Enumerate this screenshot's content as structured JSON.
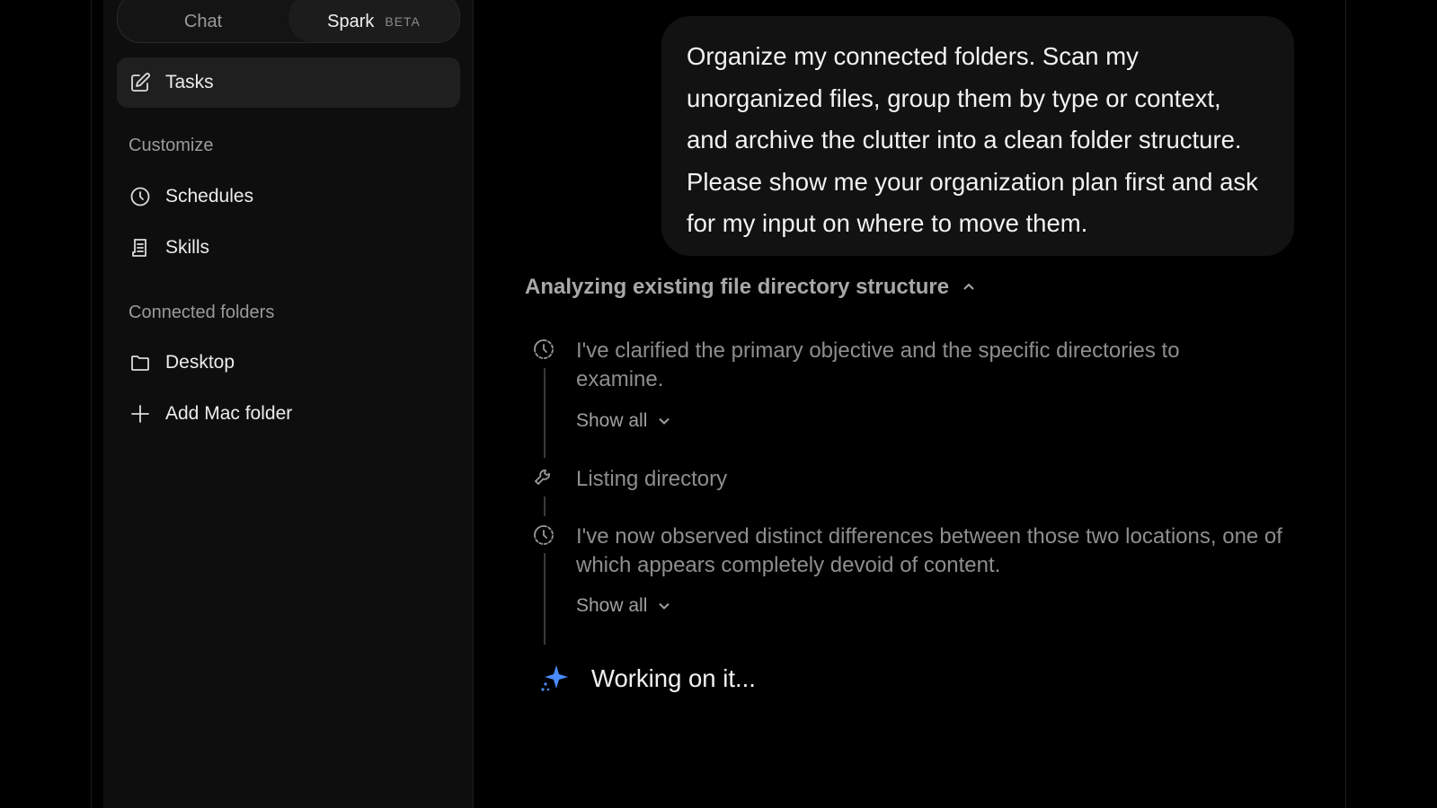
{
  "mode_toggle": {
    "chat_label": "Chat",
    "spark_label": "Spark",
    "spark_badge": "BETA"
  },
  "sidebar": {
    "tasks_label": "Tasks",
    "customize_heading": "Customize",
    "schedules_label": "Schedules",
    "skills_label": "Skills",
    "connected_heading": "Connected folders",
    "desktop_label": "Desktop",
    "add_folder_label": "Add Mac folder"
  },
  "conversation": {
    "user_message": "Organize my connected folders. Scan my unorganized files, group them by type or context, and archive the clutter into a clean folder structure. Please show me your organization plan first and ask for my input on where to move them.",
    "thinking_title": "Analyzing existing file directory structure",
    "steps": [
      {
        "icon": "thinking-icon",
        "text": "I've clarified the primary objective and the specific directories to examine.",
        "show_all": "Show all"
      },
      {
        "icon": "wrench-icon",
        "text": "Listing directory"
      },
      {
        "icon": "thinking-icon",
        "text": "I've now observed distinct differences between those two locations, one of which appears completely devoid of content.",
        "show_all": "Show all"
      }
    ],
    "working_status": "Working on it..."
  },
  "colors": {
    "background": "#000000",
    "sidebar": "#0e0e0e",
    "bubble": "#121212",
    "spark_accent": "#4a8cff"
  }
}
